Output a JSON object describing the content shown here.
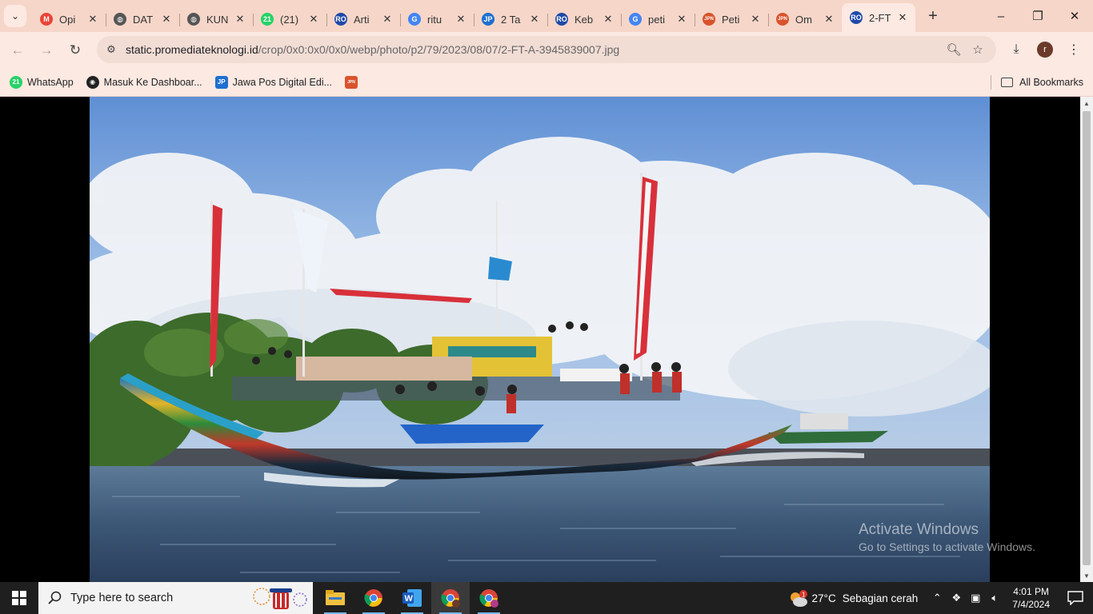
{
  "browser": {
    "tabs": [
      {
        "title": "Opi",
        "favicon": "gmail-icon",
        "color": "#ea4335",
        "glyph": "M"
      },
      {
        "title": "DAT",
        "favicon": "globe-icon",
        "color": "#555555",
        "glyph": "◍"
      },
      {
        "title": "KUN",
        "favicon": "globe-icon",
        "color": "#555555",
        "glyph": "◍"
      },
      {
        "title": "(21)",
        "favicon": "whatsapp-icon",
        "color": "#25d366",
        "glyph": "21"
      },
      {
        "title": "Arti",
        "favicon": "radar-icon",
        "color": "#1f4aa8",
        "glyph": "RO"
      },
      {
        "title": "ritu",
        "favicon": "google-icon",
        "color": "#4285f4",
        "glyph": "G"
      },
      {
        "title": "2 Ta",
        "favicon": "jawapos-icon",
        "color": "#1e6fd0",
        "glyph": "JP"
      },
      {
        "title": "Keb",
        "favicon": "radar-icon",
        "color": "#1f4aa8",
        "glyph": "RO"
      },
      {
        "title": "peti",
        "favicon": "google-icon",
        "color": "#4285f4",
        "glyph": "G"
      },
      {
        "title": "Peti",
        "favicon": "jpnn-icon",
        "color": "#d9532c",
        "glyph": "JPN"
      },
      {
        "title": "Om",
        "favicon": "jpnn-icon",
        "color": "#d9532c",
        "glyph": "JPN"
      },
      {
        "title": "2-FT",
        "favicon": "radar-icon",
        "color": "#1f4aa8",
        "glyph": "RO"
      }
    ],
    "active_tab_index": 11,
    "url_host": "static.promediateknologi.id",
    "url_path": "/crop/0x0:0x0/0x0/webp/photo/p2/79/2023/08/07/2-FT-A-3945839007.jpg",
    "bookmarks": [
      {
        "label": "WhatsApp",
        "icon": "whatsapp-icon",
        "color": "#25d366",
        "glyph": "21"
      },
      {
        "label": "Masuk Ke Dashboar...",
        "icon": "dashboard-icon",
        "color": "#222222",
        "glyph": "◉"
      },
      {
        "label": "Jawa Pos Digital Edi...",
        "icon": "jawapos-icon",
        "color": "#1e6fd0",
        "glyph": "JP"
      },
      {
        "label": "",
        "icon": "jpnn-icon",
        "color": "#d9532c",
        "glyph": "JPN"
      }
    ],
    "all_bookmarks_label": "All Bookmarks",
    "profile_initial": "r"
  },
  "watermark": {
    "line1": "Activate Windows",
    "line2": "Go to Settings to activate Windows."
  },
  "taskbar": {
    "search_placeholder": "Type here to search",
    "apps": [
      "file-explorer-icon",
      "chrome-icon",
      "word-icon",
      "chrome-profile-icon",
      "chrome-profile-h-icon"
    ],
    "weather_badge": "1",
    "weather_temp": "27°C",
    "weather_desc": "Sebagian cerah",
    "time": "4:01 PM",
    "date": "7/4/2024"
  }
}
